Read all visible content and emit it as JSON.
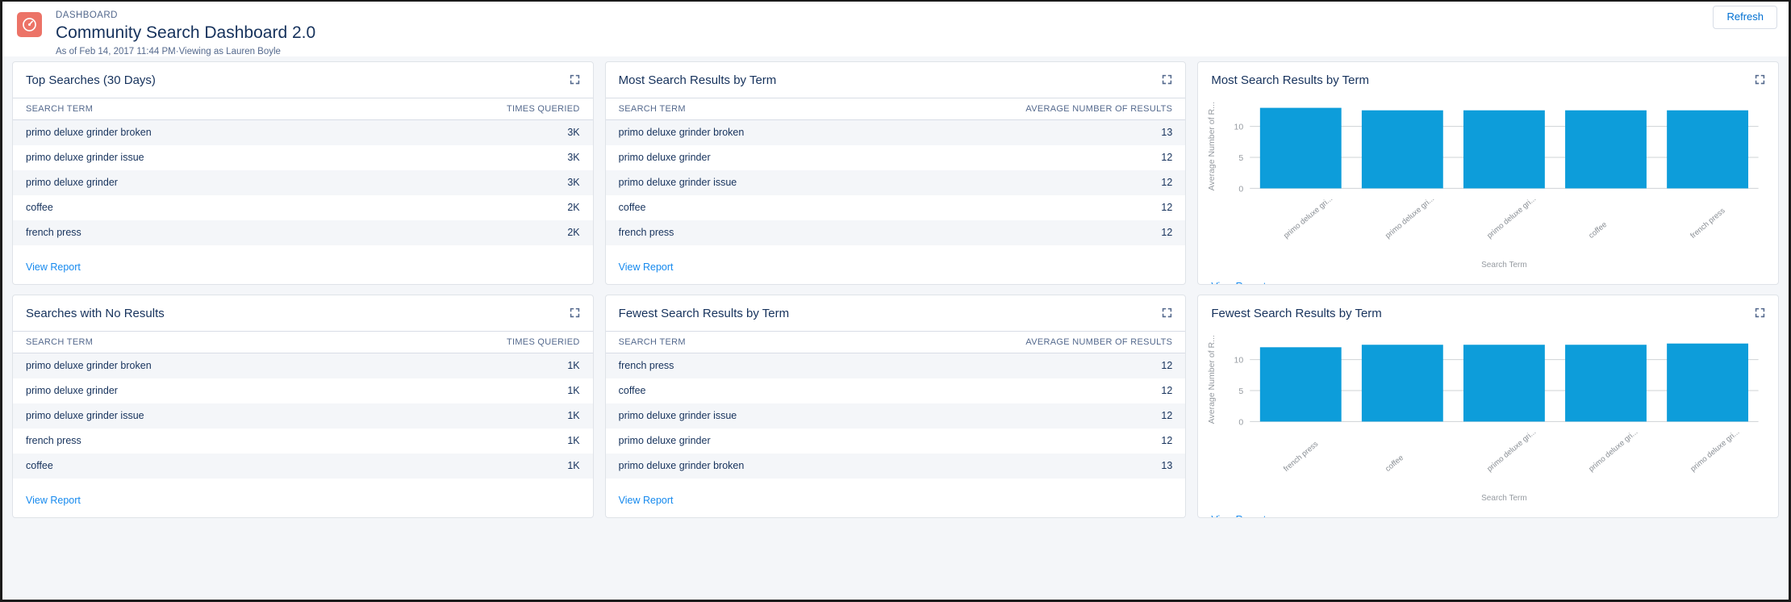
{
  "header": {
    "eyebrow": "DASHBOARD",
    "title": "Community Search Dashboard 2.0",
    "subtitle": "As of Feb 14, 2017 11:44 PM·Viewing as Lauren Boyle",
    "refresh_label": "Refresh",
    "icon": "dashboard-gauge-icon",
    "icon_color": "#ec7367",
    "link_color": "#1589ee"
  },
  "common": {
    "view_report_label": "View Report",
    "expand_icon": "expand-icon",
    "bar_color": "#0d9dda"
  },
  "cards": [
    {
      "id": "top-searches",
      "type": "table",
      "title": "Top Searches (30 Days)",
      "columns": [
        "SEARCH TERM",
        "TIMES QUERIED"
      ],
      "rows": [
        [
          "primo deluxe grinder broken",
          "3K"
        ],
        [
          "primo deluxe grinder issue",
          "3K"
        ],
        [
          "primo deluxe grinder",
          "3K"
        ],
        [
          "coffee",
          "2K"
        ],
        [
          "french press",
          "2K"
        ]
      ]
    },
    {
      "id": "most-search-results-table",
      "type": "table",
      "title": "Most Search Results by Term",
      "columns": [
        "SEARCH TERM",
        "AVERAGE NUMBER OF RESULTS"
      ],
      "rows": [
        [
          "primo deluxe grinder broken",
          "13"
        ],
        [
          "primo deluxe grinder",
          "12"
        ],
        [
          "primo deluxe grinder issue",
          "12"
        ],
        [
          "coffee",
          "12"
        ],
        [
          "french press",
          "12"
        ]
      ]
    },
    {
      "id": "most-search-results-chart",
      "type": "chart",
      "title": "Most Search Results by Term"
    },
    {
      "id": "searches-no-results",
      "type": "table",
      "title": "Searches with No Results",
      "columns": [
        "SEARCH TERM",
        "TIMES QUERIED"
      ],
      "rows": [
        [
          "primo deluxe grinder broken",
          "1K"
        ],
        [
          "primo deluxe grinder",
          "1K"
        ],
        [
          "primo deluxe grinder issue",
          "1K"
        ],
        [
          "french press",
          "1K"
        ],
        [
          "coffee",
          "1K"
        ]
      ]
    },
    {
      "id": "fewest-search-results-table",
      "type": "table",
      "title": "Fewest Search Results by Term",
      "columns": [
        "SEARCH TERM",
        "AVERAGE NUMBER OF RESULTS"
      ],
      "rows": [
        [
          "french press",
          "12"
        ],
        [
          "coffee",
          "12"
        ],
        [
          "primo deluxe grinder issue",
          "12"
        ],
        [
          "primo deluxe grinder",
          "12"
        ],
        [
          "primo deluxe grinder broken",
          "13"
        ]
      ]
    },
    {
      "id": "fewest-search-results-chart",
      "type": "chart",
      "title": "Fewest Search Results by Term"
    }
  ],
  "chart_data": [
    {
      "id": "most-search-results-chart",
      "type": "bar",
      "title": "Most Search Results by Term",
      "categories": [
        "primo deluxe gri...",
        "primo deluxe gri...",
        "primo deluxe gri...",
        "coffee",
        "french press"
      ],
      "values": [
        13,
        12.6,
        12.6,
        12.6,
        12.6
      ],
      "xlabel": "Search Term",
      "ylabel": "Average Number of R...",
      "yticks": [
        0,
        5,
        10
      ],
      "ylim": [
        0,
        13.6
      ],
      "grid": true,
      "legend": false,
      "bar_color": "#0d9dda"
    },
    {
      "id": "fewest-search-results-chart",
      "type": "bar",
      "title": "Fewest Search Results by Term",
      "categories": [
        "french press",
        "coffee",
        "primo deluxe gri...",
        "primo deluxe gri...",
        "primo deluxe gri..."
      ],
      "values": [
        12,
        12.4,
        12.4,
        12.4,
        12.6
      ],
      "xlabel": "Search Term",
      "ylabel": "Average Number of R...",
      "yticks": [
        0,
        5,
        10
      ],
      "ylim": [
        0,
        13.6
      ],
      "grid": true,
      "legend": false,
      "bar_color": "#0d9dda"
    }
  ]
}
